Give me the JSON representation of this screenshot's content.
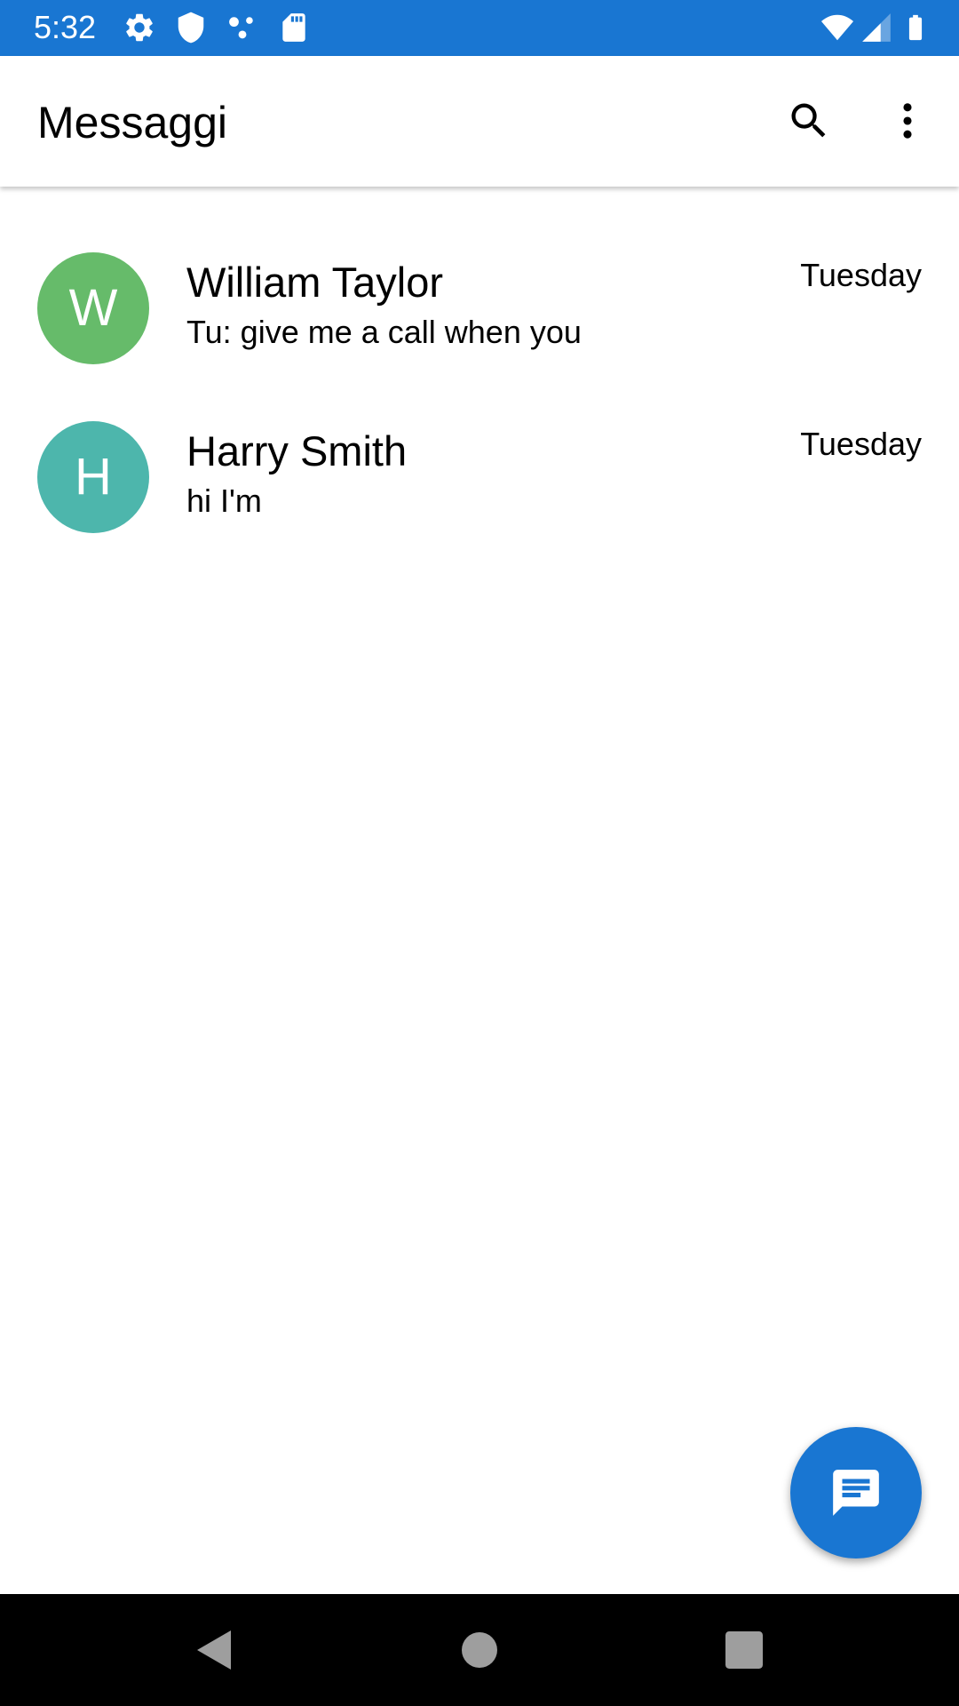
{
  "colors": {
    "status_bar": "#1976d2",
    "accent": "#1976d2",
    "avatar_w": "#66bb6a",
    "avatar_h": "#4db6ac",
    "nav_bar": "#000000",
    "nav_icons": "#9e9e9e"
  },
  "status_bar": {
    "time": "5:32",
    "icons": [
      "settings-icon",
      "shield-icon",
      "dots-icon",
      "sd-card-icon",
      "wifi-icon",
      "signal-icon",
      "battery-icon"
    ]
  },
  "app_bar": {
    "title": "Messaggi",
    "icons": [
      "search-icon",
      "more-vert-icon"
    ]
  },
  "conversations": [
    {
      "initial": "W",
      "name": "William Taylor",
      "snippet": "Tu: give me a call when you",
      "time": "Tuesday",
      "avatar_color": "#66bb6a"
    },
    {
      "initial": "H",
      "name": "Harry Smith",
      "snippet": "hi I'm",
      "time": "Tuesday",
      "avatar_color": "#4db6ac"
    }
  ],
  "fab": {
    "icon": "message-icon"
  },
  "nav_bar": {
    "icons": [
      "back-icon",
      "home-icon",
      "recents-icon"
    ]
  }
}
